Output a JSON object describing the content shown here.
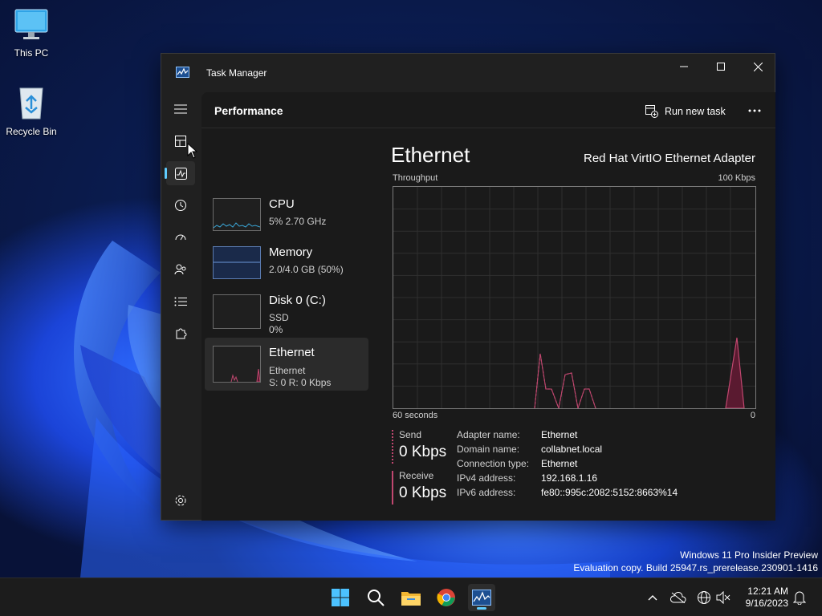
{
  "desktop": {
    "icons": [
      {
        "label": "This PC"
      },
      {
        "label": "Recycle Bin"
      }
    ],
    "watermark": {
      "line1": "Windows 11 Pro Insider Preview",
      "line2": "Evaluation copy. Build 25947.rs_prerelease.230901-1416"
    }
  },
  "window": {
    "title": "Task Manager",
    "page_title": "Performance",
    "run_new_task": "Run new task",
    "more_icon": "ellipsis-icon"
  },
  "sidebar_cards": [
    {
      "title": "CPU",
      "sub1": "5%  2.70 GHz",
      "sub2": ""
    },
    {
      "title": "Memory",
      "sub1": "2.0/4.0 GB (50%)",
      "sub2": ""
    },
    {
      "title": "Disk 0 (C:)",
      "sub1": "SSD",
      "sub2": "0%"
    },
    {
      "title": "Ethernet",
      "sub1": "Ethernet",
      "sub2": "S: 0 R: 0 Kbps"
    }
  ],
  "detail": {
    "title": "Ethernet",
    "adapter": "Red Hat VirtIO Ethernet Adapter",
    "graph_label": "Throughput",
    "graph_max": "100 Kbps",
    "graph_left": "60 seconds",
    "graph_right": "0",
    "send_label": "Send",
    "send_value": "0 Kbps",
    "receive_label": "Receive",
    "receive_value": "0 Kbps",
    "properties": [
      {
        "key": "Adapter name:",
        "value": "Ethernet"
      },
      {
        "key": "Domain name:",
        "value": "collabnet.local"
      },
      {
        "key": "Connection type:",
        "value": "Ethernet"
      },
      {
        "key": "IPv4 address:",
        "value": "192.168.1.16"
      },
      {
        "key": "IPv6 address:",
        "value": "fe80::995c:2082:5152:8663%14"
      }
    ]
  },
  "colors": {
    "accent": "#60cdff",
    "ethernet_line": "#c0476f",
    "cpu_line": "#3aa6d6",
    "memory_fill": "#1a2a4a"
  },
  "taskbar": {
    "time": "12:21 AM",
    "date": "9/16/2023"
  }
}
